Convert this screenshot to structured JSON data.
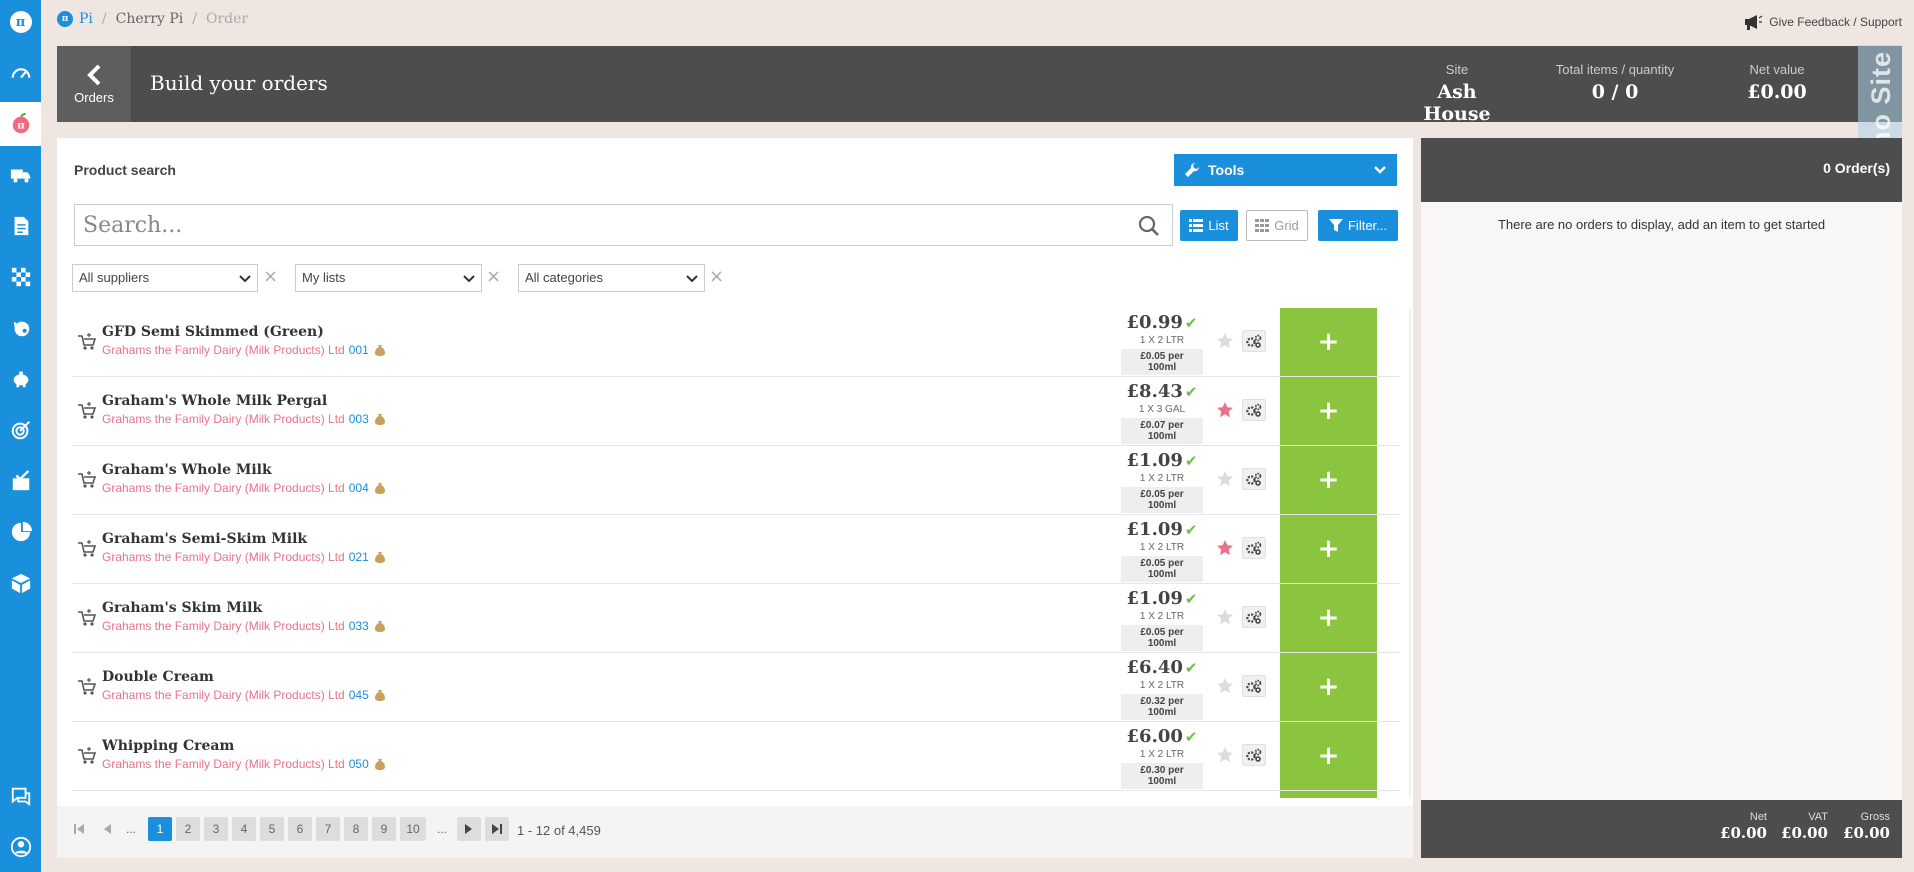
{
  "colors": {
    "accent": "#1a8fdb",
    "add_green": "#8bc43f",
    "supplier_pink": "#e87289",
    "header_dark": "#4d4d4d",
    "star_active": "#e87289"
  },
  "sidebar": {
    "items": [
      {
        "icon": "pi-logo-icon",
        "glyph": "π"
      },
      {
        "icon": "dashboard-gauge-icon"
      },
      {
        "icon": "cherry-pi-icon",
        "glyph": "π",
        "active": true
      },
      {
        "icon": "delivery-truck-icon"
      },
      {
        "icon": "document-icon"
      },
      {
        "icon": "checkered-flag-icon"
      },
      {
        "icon": "pig-head-icon"
      },
      {
        "icon": "piggy-bank-icon"
      },
      {
        "icon": "target-icon"
      },
      {
        "icon": "checklist-icon"
      },
      {
        "icon": "pie-chart-icon"
      },
      {
        "icon": "box-icon"
      },
      {
        "icon": "help-chat-icon"
      },
      {
        "icon": "user-profile-icon"
      }
    ]
  },
  "breadcrumb": {
    "root": "Pi",
    "section": "Cherry Pi",
    "current": "Order"
  },
  "feedback": {
    "label": "Give Feedback / Support"
  },
  "header": {
    "back_label": "Orders",
    "title": "Build your orders",
    "site_label": "Site",
    "site_value": "Ash House",
    "items_label": "Total items / quantity",
    "items_value": "0 / 0",
    "net_label": "Net value",
    "net_value": "£0.00",
    "demo_label": "Demo Site"
  },
  "search": {
    "section_label": "Product search",
    "tools_label": "Tools",
    "placeholder": "Search...",
    "list_label": "List",
    "grid_label": "Grid",
    "filter_label": "Filter...",
    "supplier_filter": "All suppliers",
    "list_filter": "My lists",
    "category_filter": "All categories"
  },
  "products": [
    {
      "name": "GFD Semi Skimmed (Green)",
      "supplier": "Grahams the Family Dairy (Milk Products) Ltd",
      "code": "001",
      "price": "£0.99",
      "pack": "1 X 2 LTR",
      "per": "£0.05 per 100ml",
      "starred": false
    },
    {
      "name": "Graham's Whole Milk Pergal",
      "supplier": "Grahams the Family Dairy (Milk Products) Ltd",
      "code": "003",
      "price": "£8.43",
      "pack": "1 X 3 GAL",
      "per": "£0.07 per 100ml",
      "starred": true
    },
    {
      "name": "Graham's Whole Milk",
      "supplier": "Grahams the Family Dairy (Milk Products) Ltd",
      "code": "004",
      "price": "£1.09",
      "pack": "1 X 2 LTR",
      "per": "£0.05 per 100ml",
      "starred": false
    },
    {
      "name": "Graham's Semi-Skim Milk",
      "supplier": "Grahams the Family Dairy (Milk Products) Ltd",
      "code": "021",
      "price": "£1.09",
      "pack": "1 X 2 LTR",
      "per": "£0.05 per 100ml",
      "starred": true
    },
    {
      "name": "Graham's Skim Milk",
      "supplier": "Grahams the Family Dairy (Milk Products) Ltd",
      "code": "033",
      "price": "£1.09",
      "pack": "1 X 2 LTR",
      "per": "£0.05 per 100ml",
      "starred": false
    },
    {
      "name": "Double Cream",
      "supplier": "Grahams the Family Dairy (Milk Products) Ltd",
      "code": "045",
      "price": "£6.40",
      "pack": "1 X 2 LTR",
      "per": "£0.32 per 100ml",
      "starred": false
    },
    {
      "name": "Whipping Cream",
      "supplier": "Grahams the Family Dairy (Milk Products) Ltd",
      "code": "050",
      "price": "£6.00",
      "pack": "1 X 2 LTR",
      "per": "£0.30 per 100ml",
      "starred": false
    }
  ],
  "pagination": {
    "pages": [
      "1",
      "2",
      "3",
      "4",
      "5",
      "6",
      "7",
      "8",
      "9",
      "10"
    ],
    "current": "1",
    "ellipsis": "...",
    "info": "1 - 12 of 4,459"
  },
  "orders": {
    "count_label": "0 Order(s)",
    "empty_message": "There are no orders to display, add an item to get started",
    "net_label": "Net",
    "net_value": "£0.00",
    "vat_label": "VAT",
    "vat_value": "£0.00",
    "gross_label": "Gross",
    "gross_value": "£0.00"
  }
}
